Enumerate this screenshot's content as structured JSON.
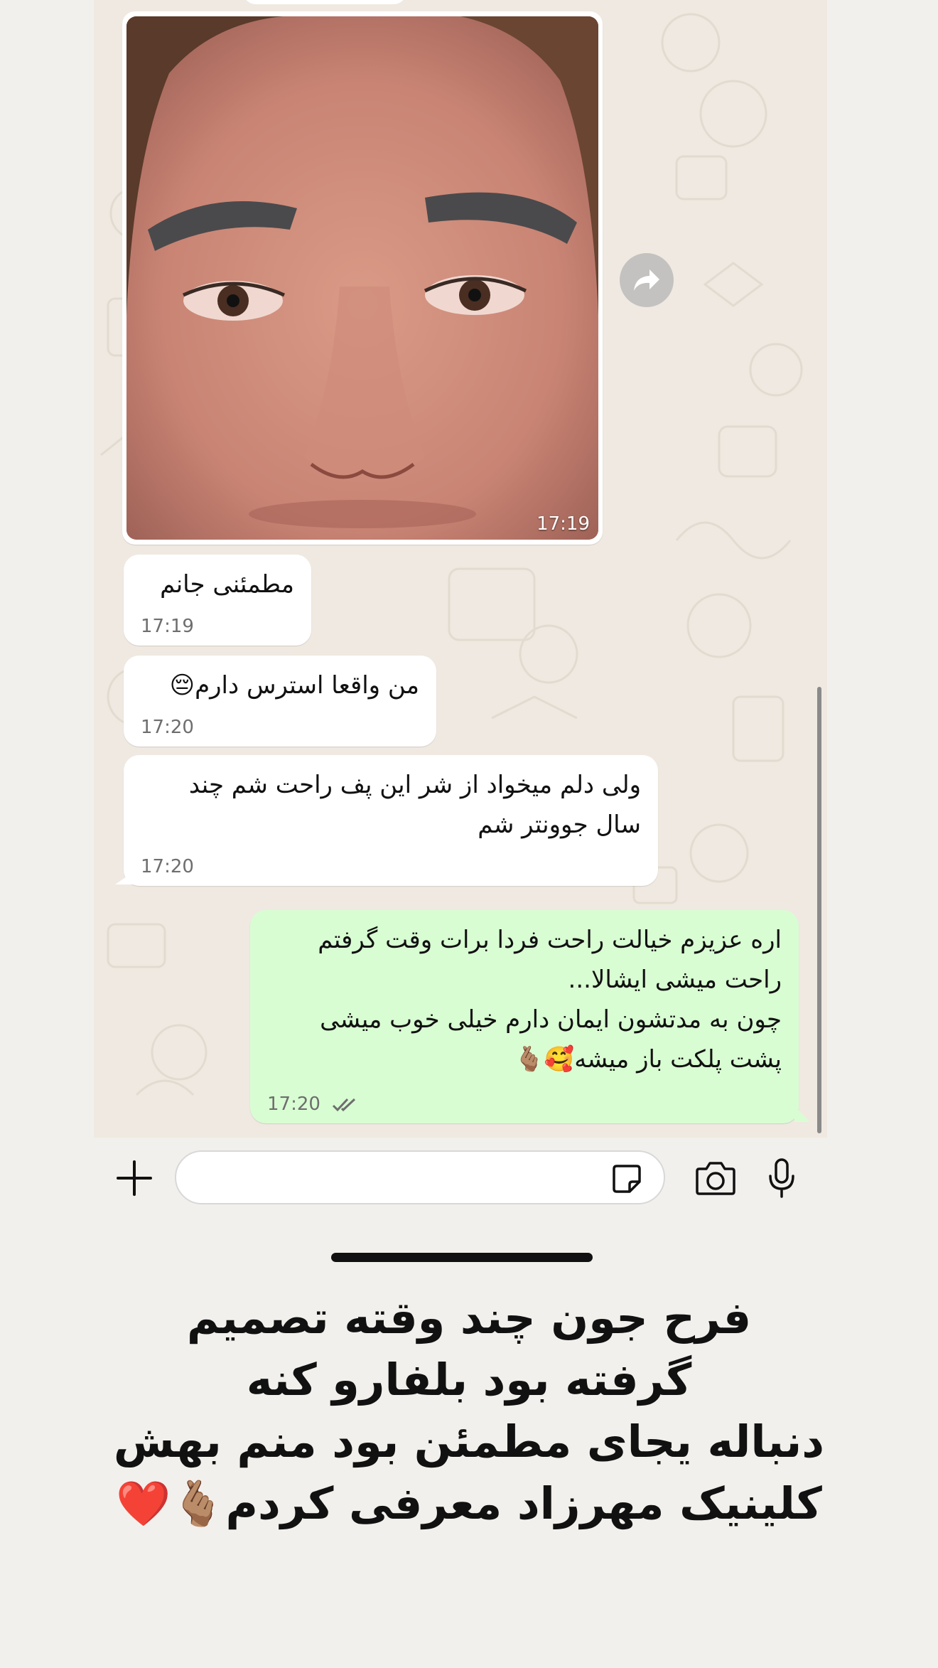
{
  "chat": {
    "photo_message": {
      "time": "17:19"
    },
    "messages": [
      {
        "direction": "incoming",
        "text": "مطمئنی جانم",
        "time": "17:19"
      },
      {
        "direction": "incoming",
        "text": "من واقعا استرس دارم😔",
        "time": "17:20"
      },
      {
        "direction": "incoming",
        "lines": [
          "ولی دلم میخواد از شر این پف راحت شم چند",
          "سال جوونتر شم"
        ],
        "time": "17:20"
      },
      {
        "direction": "outgoing",
        "lines": [
          "اره عزیزم خیالت راحت فردا برات وقت گرفتم",
          "راحت میشی ایشالا...",
          "چون به مدتشون ایمان دارم خیلی خوب میشی",
          "پشت پلکت باز میشه🥰🫰🏽"
        ],
        "time": "17:20",
        "status": "read"
      }
    ]
  },
  "icons": {
    "forward": "forward-icon",
    "plus": "plus-icon",
    "sticker": "sticker-icon",
    "camera": "camera-icon",
    "mic": "mic-icon",
    "read_ticks": "double-check-icon"
  },
  "colors": {
    "chat_background": "#efe9e1",
    "incoming_bubble": "#ffffff",
    "outgoing_bubble": "#d9fdd3",
    "tick_color": "#6e6e6e",
    "page_background": "#f2f0ec"
  },
  "caption": {
    "lines": [
      "فرح جون چند وقته تصمیم",
      "گرفته بود بلفارو کنه",
      "دنباله یجای مطمئن بود منم بهش",
      "کلینیک مهرزاد معرفی کردم🫰🏽❤️"
    ]
  }
}
